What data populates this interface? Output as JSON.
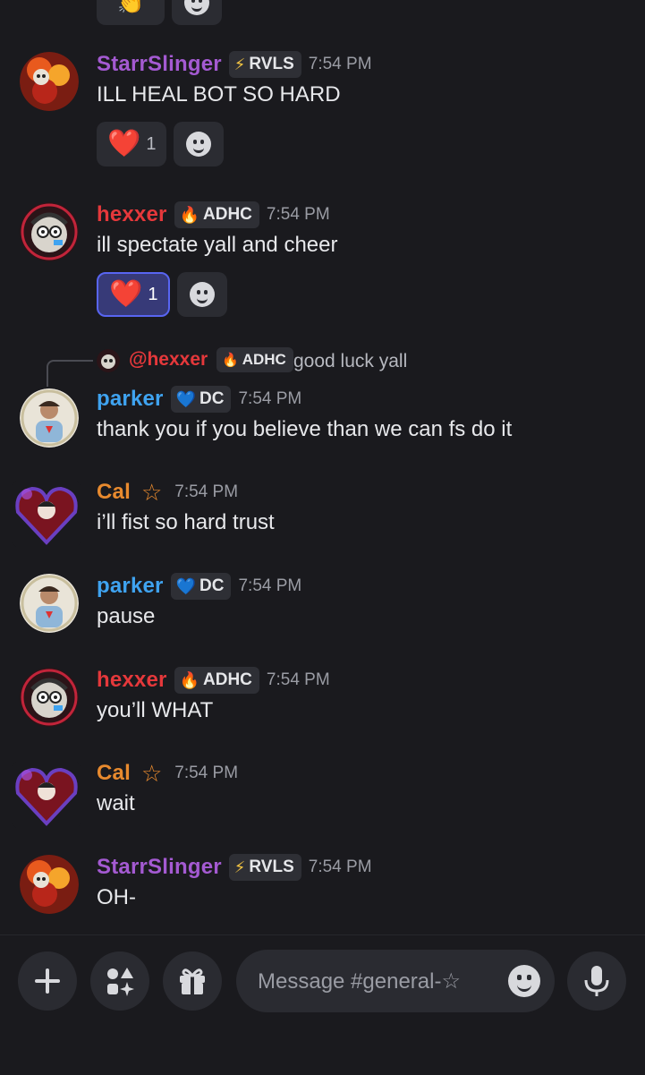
{
  "colors": {
    "background": "#1a1a1e",
    "starr": "#a45ad2",
    "hexxer": "#e5383b",
    "parker": "#3fa3f0",
    "cal": "#e88a2e",
    "reaction_active": "#373a78"
  },
  "messages": [
    {
      "user": "StarrSlinger",
      "tag_glyph": "⚡",
      "tag": "RVLS",
      "time": "7:54 PM",
      "text": "ILL HEAL BOT SO HARD",
      "reaction_emoji": "❤️",
      "reaction_count": "1"
    },
    {
      "user": "hexxer",
      "tag_glyph": "🔥",
      "tag": "ADHC",
      "time": "7:54 PM",
      "text": "ill spectate yall and cheer",
      "reaction_emoji": "❤️",
      "reaction_count": "1"
    },
    {
      "user": "parker",
      "tag_glyph": "💙",
      "tag": "DC",
      "time": "7:54 PM",
      "text": "thank you if you believe than we can fs do it"
    },
    {
      "user": "Cal",
      "star": "☆",
      "time": "7:54 PM",
      "text": "i’ll fist so hard trust"
    },
    {
      "user": "parker",
      "tag_glyph": "💙",
      "tag": "DC",
      "time": "7:54 PM",
      "text": "pause"
    },
    {
      "user": "hexxer",
      "tag_glyph": "🔥",
      "tag": "ADHC",
      "time": "7:54 PM",
      "text": "you’ll WHAT"
    },
    {
      "user": "Cal",
      "star": "☆",
      "time": "7:54 PM",
      "text": "wait"
    },
    {
      "user": "StarrSlinger",
      "tag_glyph": "⚡",
      "tag": "RVLS",
      "time": "7:54 PM",
      "text": "OH-"
    }
  ],
  "reply": {
    "mention": "@hexxer",
    "tag_glyph": "🔥",
    "tag": "ADHC",
    "text": "good luck yall"
  },
  "composer": {
    "placeholder": "Message #general-☆"
  },
  "icons": {
    "plus": "plus-icon",
    "apps": "apps-icon",
    "gift": "gift-icon",
    "emoji": "emoji-icon",
    "mic": "microphone-icon"
  }
}
